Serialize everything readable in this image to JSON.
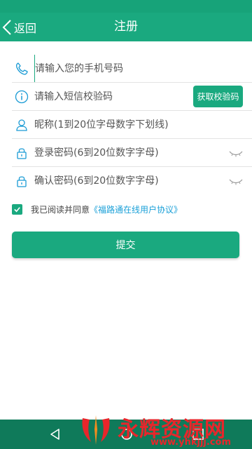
{
  "header": {
    "back_label": "返回",
    "title": "注册"
  },
  "form": {
    "phone_placeholder": "请输入您的手机号码",
    "sms_placeholder": "请输入短信校验码",
    "get_code_label": "获取校验码",
    "nickname_placeholder": "昵称(1到20位字母数字下划线)",
    "password_placeholder": "登录密码(6到20位数字字母)",
    "confirm_placeholder": "确认密码(6到20位数字字母)"
  },
  "agreement": {
    "checked": true,
    "text": "我已阅读并同意",
    "link": "《福路通在线用户协议》"
  },
  "submit_label": "提交",
  "watermark": {
    "text": "永辉资源网",
    "url": "www.yhkjjj.com"
  },
  "colors": {
    "primary": "#1aa97f",
    "link": "#1aa0d8",
    "watermark": "#e8262b"
  }
}
